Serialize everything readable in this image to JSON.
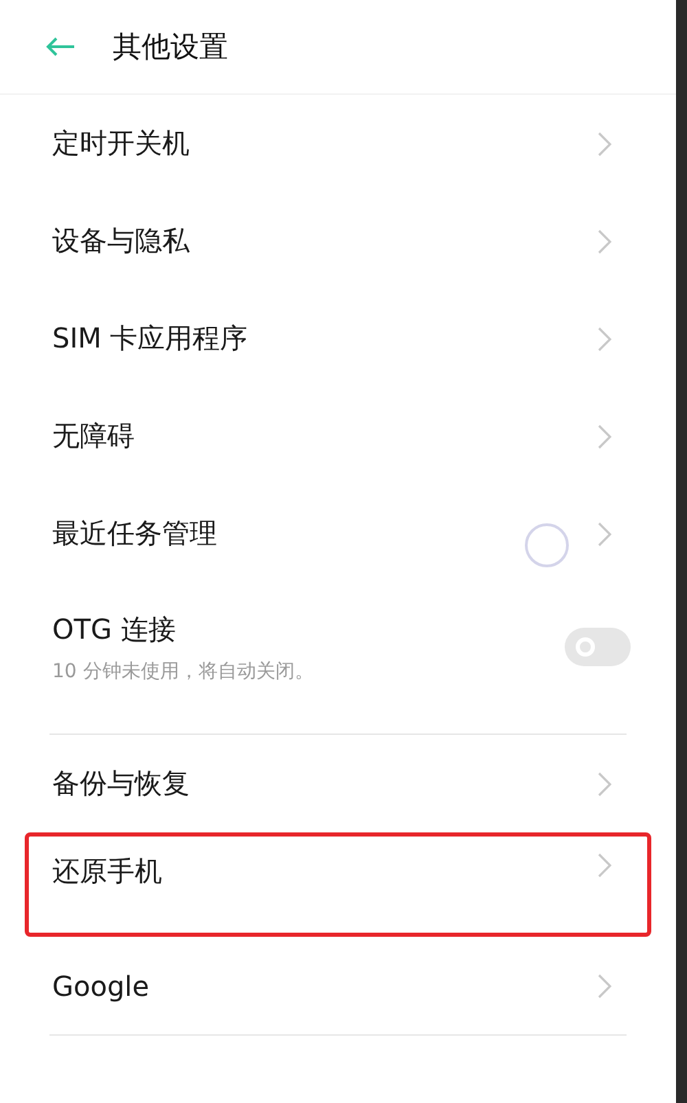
{
  "header": {
    "title": "其他设置"
  },
  "items": [
    {
      "kind": "link",
      "label": "定时开关机",
      "highlighted": false
    },
    {
      "kind": "link",
      "label": "设备与隐私",
      "highlighted": false
    },
    {
      "kind": "link",
      "label": "SIM 卡应用程序",
      "highlighted": false
    },
    {
      "kind": "link",
      "label": "无障碍",
      "highlighted": false
    },
    {
      "kind": "link",
      "label": "最近任务管理",
      "highlighted": false
    },
    {
      "kind": "toggle",
      "label": "OTG 连接",
      "subtitle": "10 分钟未使用，将自动关闭。",
      "on": false
    },
    {
      "kind": "divider"
    },
    {
      "kind": "link",
      "label": "备份与恢复",
      "highlighted": false
    },
    {
      "kind": "link",
      "label": "还原手机",
      "highlighted": true
    },
    {
      "kind": "link",
      "label": "Google",
      "highlighted": false
    },
    {
      "kind": "divider"
    }
  ]
}
